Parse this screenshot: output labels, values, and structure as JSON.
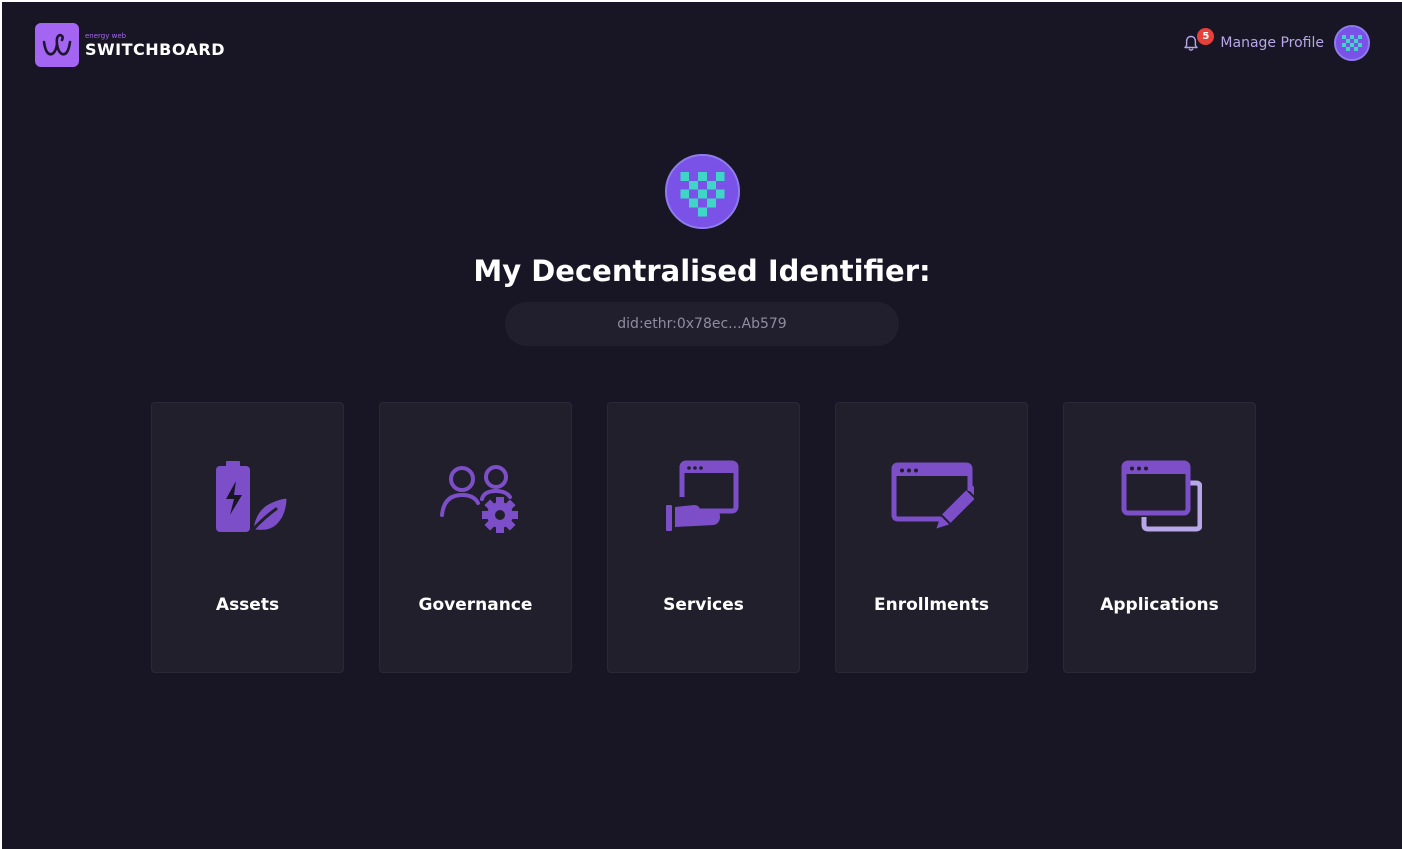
{
  "header": {
    "logo_small": "energy web",
    "logo_big": "SWITCHBOARD",
    "notification_count": "5",
    "manage_profile": "Manage Profile"
  },
  "main": {
    "title": "My Decentralised Identifier:",
    "did": "did:ethr:0x78ec...Ab579"
  },
  "cards": [
    {
      "label": "Assets",
      "icon": "battery-leaf-icon"
    },
    {
      "label": "Governance",
      "icon": "users-gear-icon"
    },
    {
      "label": "Services",
      "icon": "hand-window-icon"
    },
    {
      "label": "Enrollments",
      "icon": "window-pen-icon"
    },
    {
      "label": "Applications",
      "icon": "windows-stack-icon"
    }
  ],
  "colors": {
    "background": "#181624",
    "card": "#211f2c",
    "accent": "#a466f2",
    "icon": "#7c4fc9",
    "badge": "#e6403a",
    "avatar_cyan": "#3fd6c8"
  }
}
